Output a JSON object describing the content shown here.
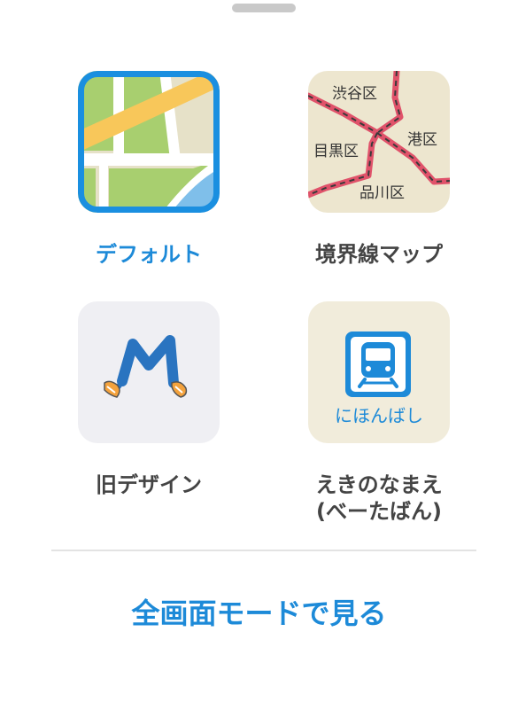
{
  "map_styles": [
    {
      "id": "default",
      "label": "デフォルト",
      "selected": true,
      "icon": "default-map-icon"
    },
    {
      "id": "boundary",
      "label": "境界線マップ",
      "selected": false,
      "icon": "boundary-map-icon",
      "ward_names": [
        "渋谷区",
        "目黒区",
        "港区",
        "品川区"
      ]
    },
    {
      "id": "old-design",
      "label": "旧デザイン",
      "selected": false,
      "icon": "old-design-m-icon"
    },
    {
      "id": "station-names",
      "label_line1": "えきのなまえ",
      "label_line2": "(べーたばん)",
      "selected": false,
      "icon": "train-icon",
      "station_name": "にほんばし"
    }
  ],
  "fullscreen_button": {
    "label": "全画面モードで見る"
  },
  "colors": {
    "accent": "#1d8ad8",
    "label": "#444444",
    "map_green": "#a8cf6f",
    "map_beige": "#e6e1c8",
    "map_road_yellow": "#f8c75a",
    "map_water": "#7fbfea",
    "tile_gray": "#efeff3",
    "tile_cream": "#f1ecdb",
    "boundary_line": "#e0526a"
  }
}
